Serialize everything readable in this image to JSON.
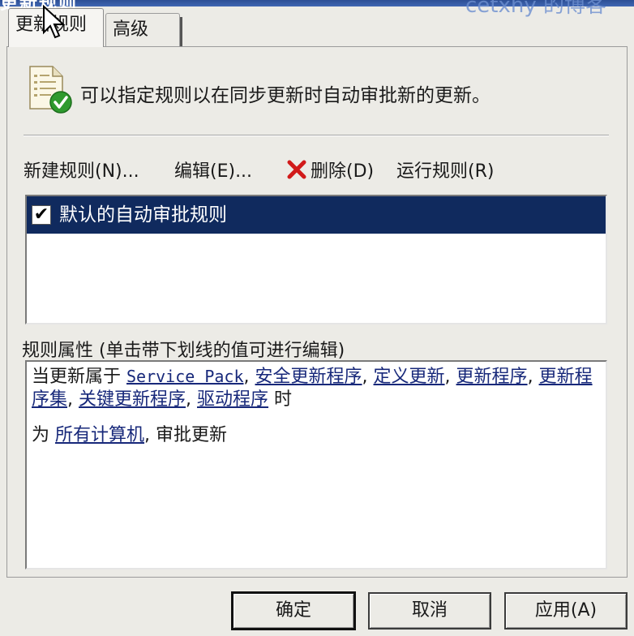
{
  "window": {
    "title_fragment": "更新规则",
    "watermark": "cetxhy 的博客"
  },
  "tabs": [
    {
      "label": "更新规则"
    },
    {
      "label": "高级"
    }
  ],
  "header": {
    "text": "可以指定规则以在同步更新时自动审批新的更新。",
    "icon": "document-check-icon"
  },
  "toolbar": {
    "new_label": "新建规则(N)...",
    "edit_label": "编辑(E)...",
    "delete_label": "删除(D)",
    "run_label": "运行规则(R)"
  },
  "rules": [
    {
      "label": "默认的自动审批规则",
      "checked": true,
      "selected": true
    }
  ],
  "properties": {
    "label": "规则属性 (单击带下划线的值可进行编辑)",
    "line1_prefix": "当更新属于",
    "classifications": [
      "Service Pack",
      "安全更新程序",
      "定义更新",
      "更新程序",
      "更新程序集",
      "关键更新程序",
      "驱动程序"
    ],
    "line1_suffix": "时",
    "line2_prefix": "为",
    "computers": "所有计算机",
    "line2_suffix": "审批更新"
  },
  "buttons": {
    "ok": "确定",
    "cancel": "取消",
    "apply": "应用(A)"
  }
}
